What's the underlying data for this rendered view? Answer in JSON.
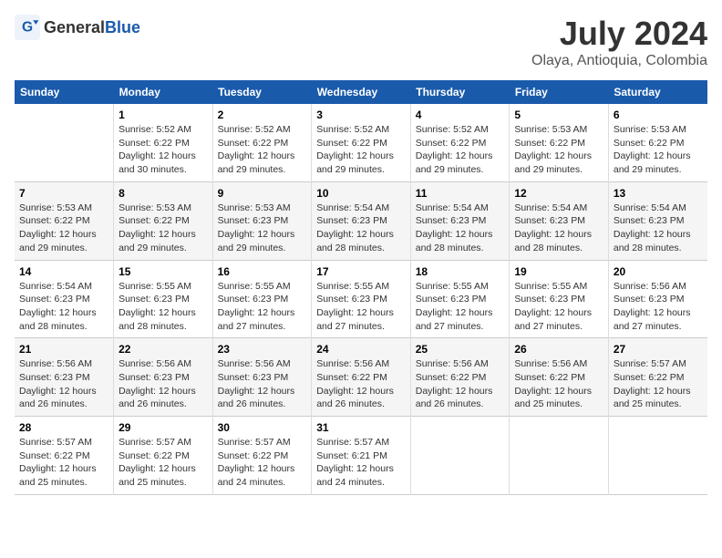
{
  "header": {
    "logo_general": "General",
    "logo_blue": "Blue",
    "title": "July 2024",
    "subtitle": "Olaya, Antioquia, Colombia"
  },
  "weekdays": [
    "Sunday",
    "Monday",
    "Tuesday",
    "Wednesday",
    "Thursday",
    "Friday",
    "Saturday"
  ],
  "weeks": [
    [
      {
        "num": "",
        "info": ""
      },
      {
        "num": "1",
        "info": "Sunrise: 5:52 AM\nSunset: 6:22 PM\nDaylight: 12 hours\nand 30 minutes."
      },
      {
        "num": "2",
        "info": "Sunrise: 5:52 AM\nSunset: 6:22 PM\nDaylight: 12 hours\nand 29 minutes."
      },
      {
        "num": "3",
        "info": "Sunrise: 5:52 AM\nSunset: 6:22 PM\nDaylight: 12 hours\nand 29 minutes."
      },
      {
        "num": "4",
        "info": "Sunrise: 5:52 AM\nSunset: 6:22 PM\nDaylight: 12 hours\nand 29 minutes."
      },
      {
        "num": "5",
        "info": "Sunrise: 5:53 AM\nSunset: 6:22 PM\nDaylight: 12 hours\nand 29 minutes."
      },
      {
        "num": "6",
        "info": "Sunrise: 5:53 AM\nSunset: 6:22 PM\nDaylight: 12 hours\nand 29 minutes."
      }
    ],
    [
      {
        "num": "7",
        "info": "Sunrise: 5:53 AM\nSunset: 6:22 PM\nDaylight: 12 hours\nand 29 minutes."
      },
      {
        "num": "8",
        "info": "Sunrise: 5:53 AM\nSunset: 6:22 PM\nDaylight: 12 hours\nand 29 minutes."
      },
      {
        "num": "9",
        "info": "Sunrise: 5:53 AM\nSunset: 6:23 PM\nDaylight: 12 hours\nand 29 minutes."
      },
      {
        "num": "10",
        "info": "Sunrise: 5:54 AM\nSunset: 6:23 PM\nDaylight: 12 hours\nand 28 minutes."
      },
      {
        "num": "11",
        "info": "Sunrise: 5:54 AM\nSunset: 6:23 PM\nDaylight: 12 hours\nand 28 minutes."
      },
      {
        "num": "12",
        "info": "Sunrise: 5:54 AM\nSunset: 6:23 PM\nDaylight: 12 hours\nand 28 minutes."
      },
      {
        "num": "13",
        "info": "Sunrise: 5:54 AM\nSunset: 6:23 PM\nDaylight: 12 hours\nand 28 minutes."
      }
    ],
    [
      {
        "num": "14",
        "info": "Sunrise: 5:54 AM\nSunset: 6:23 PM\nDaylight: 12 hours\nand 28 minutes."
      },
      {
        "num": "15",
        "info": "Sunrise: 5:55 AM\nSunset: 6:23 PM\nDaylight: 12 hours\nand 28 minutes."
      },
      {
        "num": "16",
        "info": "Sunrise: 5:55 AM\nSunset: 6:23 PM\nDaylight: 12 hours\nand 27 minutes."
      },
      {
        "num": "17",
        "info": "Sunrise: 5:55 AM\nSunset: 6:23 PM\nDaylight: 12 hours\nand 27 minutes."
      },
      {
        "num": "18",
        "info": "Sunrise: 5:55 AM\nSunset: 6:23 PM\nDaylight: 12 hours\nand 27 minutes."
      },
      {
        "num": "19",
        "info": "Sunrise: 5:55 AM\nSunset: 6:23 PM\nDaylight: 12 hours\nand 27 minutes."
      },
      {
        "num": "20",
        "info": "Sunrise: 5:56 AM\nSunset: 6:23 PM\nDaylight: 12 hours\nand 27 minutes."
      }
    ],
    [
      {
        "num": "21",
        "info": "Sunrise: 5:56 AM\nSunset: 6:23 PM\nDaylight: 12 hours\nand 26 minutes."
      },
      {
        "num": "22",
        "info": "Sunrise: 5:56 AM\nSunset: 6:23 PM\nDaylight: 12 hours\nand 26 minutes."
      },
      {
        "num": "23",
        "info": "Sunrise: 5:56 AM\nSunset: 6:23 PM\nDaylight: 12 hours\nand 26 minutes."
      },
      {
        "num": "24",
        "info": "Sunrise: 5:56 AM\nSunset: 6:22 PM\nDaylight: 12 hours\nand 26 minutes."
      },
      {
        "num": "25",
        "info": "Sunrise: 5:56 AM\nSunset: 6:22 PM\nDaylight: 12 hours\nand 26 minutes."
      },
      {
        "num": "26",
        "info": "Sunrise: 5:56 AM\nSunset: 6:22 PM\nDaylight: 12 hours\nand 25 minutes."
      },
      {
        "num": "27",
        "info": "Sunrise: 5:57 AM\nSunset: 6:22 PM\nDaylight: 12 hours\nand 25 minutes."
      }
    ],
    [
      {
        "num": "28",
        "info": "Sunrise: 5:57 AM\nSunset: 6:22 PM\nDaylight: 12 hours\nand 25 minutes."
      },
      {
        "num": "29",
        "info": "Sunrise: 5:57 AM\nSunset: 6:22 PM\nDaylight: 12 hours\nand 25 minutes."
      },
      {
        "num": "30",
        "info": "Sunrise: 5:57 AM\nSunset: 6:22 PM\nDaylight: 12 hours\nand 24 minutes."
      },
      {
        "num": "31",
        "info": "Sunrise: 5:57 AM\nSunset: 6:21 PM\nDaylight: 12 hours\nand 24 minutes."
      },
      {
        "num": "",
        "info": ""
      },
      {
        "num": "",
        "info": ""
      },
      {
        "num": "",
        "info": ""
      }
    ]
  ]
}
